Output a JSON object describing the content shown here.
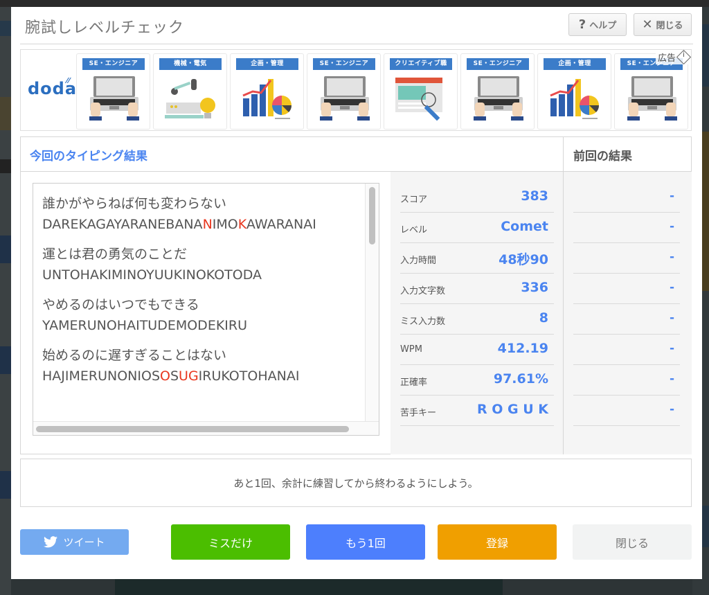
{
  "modal": {
    "title": "腕試しレベルチェック",
    "help_button": {
      "icon": "question-icon",
      "glyph": "?",
      "label": "ヘルプ"
    },
    "close_button": {
      "icon": "close-icon",
      "glyph": "✕",
      "label": "閉じる"
    }
  },
  "ad": {
    "logo": "doda",
    "ad_label": "広告",
    "cards": [
      {
        "label": "SE・エンジニア",
        "art": "laptop-hands"
      },
      {
        "label": "機械・電気",
        "art": "robot-arm-bulb"
      },
      {
        "label": "企画・管理",
        "art": "bar-pie-chart"
      },
      {
        "label": "SE・エンジニア",
        "art": "laptop-hands"
      },
      {
        "label": "クリエイティブ職",
        "art": "browser-pen"
      },
      {
        "label": "SE・エンジニア",
        "art": "laptop-hands"
      },
      {
        "label": "企画・管理",
        "art": "bar-pie-chart"
      },
      {
        "label": "SE・エンジニア",
        "art": "laptop-hands"
      }
    ]
  },
  "results": {
    "current_title": "今回のタイピング結果",
    "previous_title": "前回の結果",
    "sentences": [
      {
        "japanese": "誰かがやらねば何も変わらない",
        "romaji_segments": [
          {
            "text": "DAREKAGAYARANEBANA",
            "miss": false
          },
          {
            "text": "N",
            "miss": true
          },
          {
            "text": "IMO",
            "miss": false
          },
          {
            "text": "K",
            "miss": true
          },
          {
            "text": "AWARANAI",
            "miss": false
          }
        ]
      },
      {
        "japanese": "運とは君の勇気のことだ",
        "romaji_segments": [
          {
            "text": "UNTOHAKIMINOYUUKINOKOTODA",
            "miss": false
          }
        ]
      },
      {
        "japanese": "やめるのはいつでもできる",
        "romaji_segments": [
          {
            "text": "YAMERUNOHAITUDEMODEKIRU",
            "miss": false
          }
        ]
      },
      {
        "japanese": "始めるのに遅すぎることはない",
        "romaji_segments": [
          {
            "text": "HAJIMERUNONIOS",
            "miss": false
          },
          {
            "text": "O",
            "miss": true
          },
          {
            "text": "S",
            "miss": false
          },
          {
            "text": "UG",
            "miss": true
          },
          {
            "text": "IRUKOTOHANAI",
            "miss": false
          }
        ]
      }
    ],
    "stats": [
      {
        "label": "スコア",
        "value": "383",
        "previous": "-"
      },
      {
        "label": "レベル",
        "value": "Comet",
        "previous": "-"
      },
      {
        "label": "入力時間",
        "value": "48秒90",
        "previous": "-"
      },
      {
        "label": "入力文字数",
        "value": "336",
        "previous": "-"
      },
      {
        "label": "ミス入力数",
        "value": "8",
        "previous": "-"
      },
      {
        "label": "WPM",
        "value": "412.19",
        "previous": "-"
      },
      {
        "label": "正確率",
        "value": "97.61%",
        "previous": "-"
      },
      {
        "label": "苦手キー",
        "value": "R O G U K",
        "previous": "-"
      }
    ]
  },
  "comment": "あと1回、余計に練習してから終わるようにしよう。",
  "buttons": {
    "tweet": {
      "label": "ツイート",
      "icon": "twitter-bird-icon"
    },
    "miss_only": "ミスだけ",
    "retry": "もう1回",
    "register": "登録",
    "close": "閉じる"
  },
  "colors": {
    "accent_blue": "#4a84f0",
    "miss_red": "#e8361e",
    "tweet_blue": "#74aaf0",
    "miss_green": "#4bbe00",
    "retry_blue": "#4d7ffd",
    "register_orange": "#f09f00",
    "ad_label_blue": "#3b7cc9"
  }
}
